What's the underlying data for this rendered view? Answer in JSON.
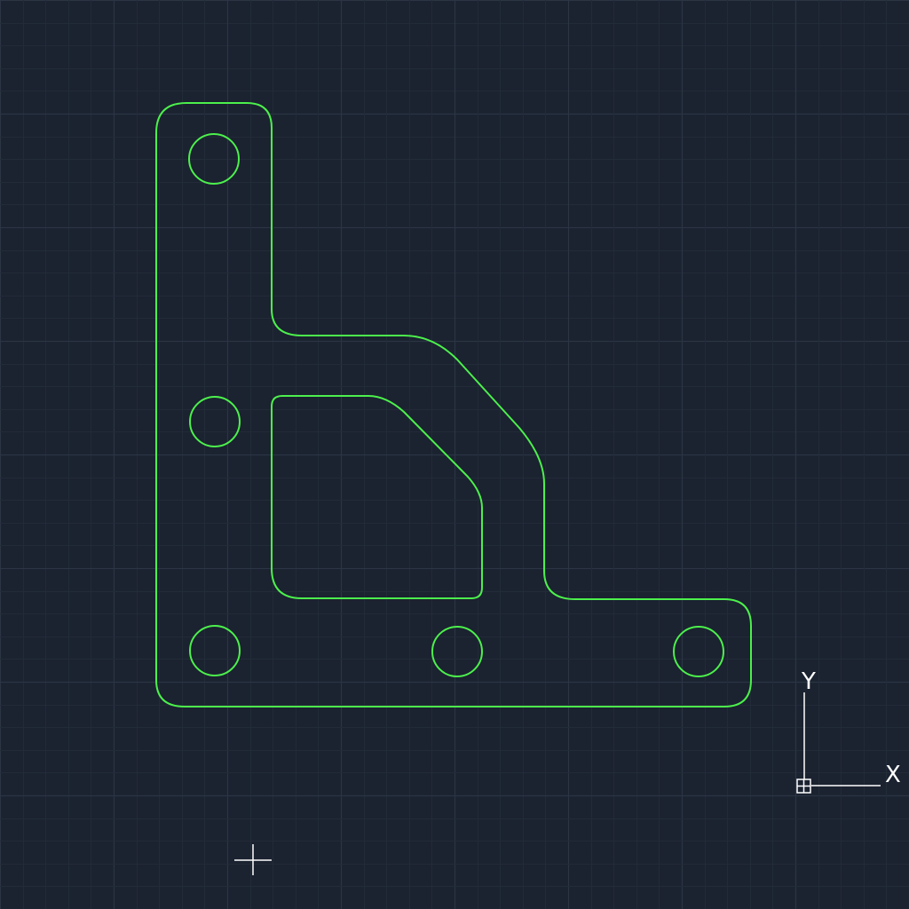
{
  "canvas": {
    "background": "#1b2230",
    "grid_minor_color": "#222b38",
    "grid_major_color": "#2b3544"
  },
  "part": {
    "stroke_color": "#4cf04c",
    "outline": "l-bracket-outline",
    "cutout": "triangular-cutout",
    "hole_count": 5
  },
  "ucs": {
    "color": "#ffffff",
    "x_label": "X",
    "y_label": "Y"
  },
  "cursor": {
    "color": "#ffffff",
    "icon": "crosshair-cursor-icon"
  }
}
